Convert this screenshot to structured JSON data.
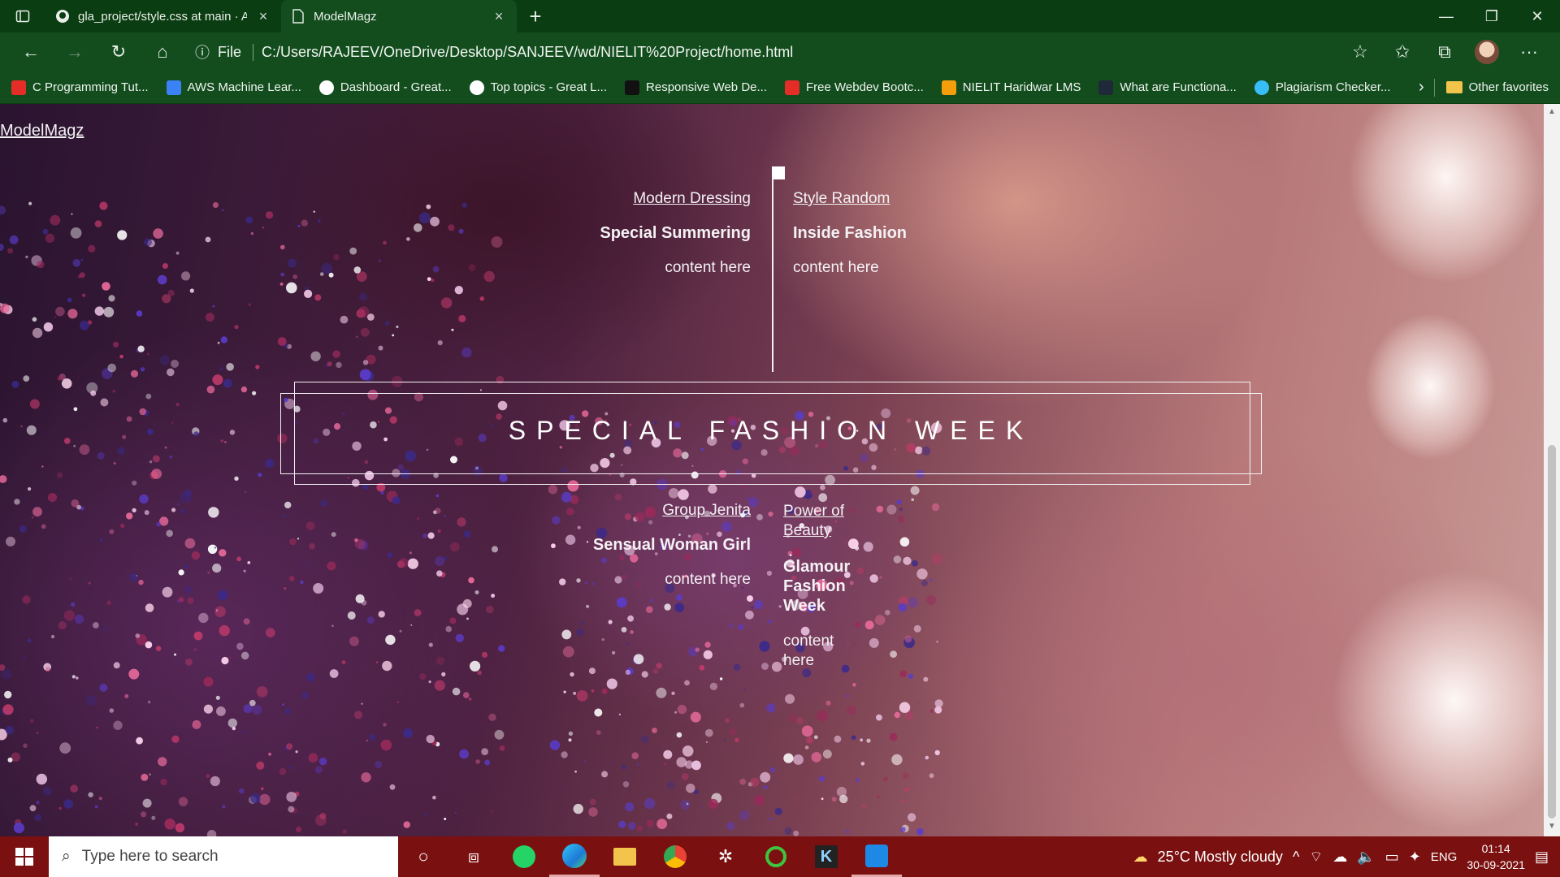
{
  "browser": {
    "tabs": [
      {
        "title": "gla_project/style.css at main · AM",
        "close": "×"
      },
      {
        "title": "ModelMagz",
        "close": "×"
      }
    ],
    "new_tab": "+",
    "address": {
      "scheme_label": "File",
      "url": "C:/Users/RAJEEV/OneDrive/Desktop/SANJEEV/wd/NIELIT%20Project/home.html"
    },
    "favorites": [
      {
        "label": "C Programming Tut...",
        "color": "#e52d27"
      },
      {
        "label": "AWS Machine Lear...",
        "color": "#3b82f6"
      },
      {
        "label": "Dashboard - Great...",
        "color": "#ffffff"
      },
      {
        "label": "Top topics - Great L...",
        "color": "#ffffff"
      },
      {
        "label": "Responsive Web De...",
        "color": "#111111"
      },
      {
        "label": "Free Webdev Bootc...",
        "color": "#e52d27"
      },
      {
        "label": "NIELIT Haridwar LMS",
        "color": "#f59e0b"
      },
      {
        "label": "What are Functiona...",
        "color": "#1f2937"
      },
      {
        "label": "Plagiarism Checker...",
        "color": "#38bdf8"
      }
    ],
    "other_favorites": "Other favorites"
  },
  "page": {
    "brand": "ModelMagz",
    "stories_top": [
      {
        "tag": "Modern Dressing",
        "title": "Special Summering",
        "body": "content here"
      },
      {
        "tag": "Style Random",
        "title": "Inside Fashion",
        "body": "content here"
      }
    ],
    "banner": "SPECIAL FASHION WEEK",
    "stories_bottom": [
      {
        "tag": "Group Jenita",
        "title": "Sensual Woman Girl",
        "body": "content here"
      },
      {
        "tag": "Power of Beauty",
        "title": "Glamour Fashion Week",
        "body": "content here"
      }
    ]
  },
  "taskbar": {
    "search_placeholder": "Type here to search",
    "weather": "25°C  Mostly cloudy",
    "language": "ENG",
    "time": "01:14",
    "date": "30-09-2021"
  }
}
